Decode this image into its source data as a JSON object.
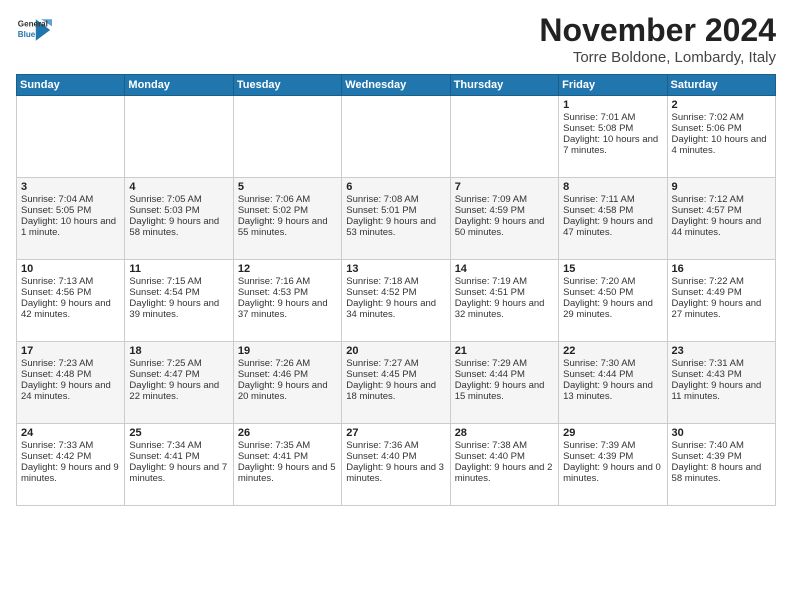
{
  "logo": {
    "general": "General",
    "blue": "Blue"
  },
  "title": "November 2024",
  "location": "Torre Boldone, Lombardy, Italy",
  "weekdays": [
    "Sunday",
    "Monday",
    "Tuesday",
    "Wednesday",
    "Thursday",
    "Friday",
    "Saturday"
  ],
  "weeks": [
    [
      {
        "day": "",
        "info": ""
      },
      {
        "day": "",
        "info": ""
      },
      {
        "day": "",
        "info": ""
      },
      {
        "day": "",
        "info": ""
      },
      {
        "day": "",
        "info": ""
      },
      {
        "day": "1",
        "info": "Sunrise: 7:01 AM\nSunset: 5:08 PM\nDaylight: 10 hours and 7 minutes."
      },
      {
        "day": "2",
        "info": "Sunrise: 7:02 AM\nSunset: 5:06 PM\nDaylight: 10 hours and 4 minutes."
      }
    ],
    [
      {
        "day": "3",
        "info": "Sunrise: 7:04 AM\nSunset: 5:05 PM\nDaylight: 10 hours and 1 minute."
      },
      {
        "day": "4",
        "info": "Sunrise: 7:05 AM\nSunset: 5:03 PM\nDaylight: 9 hours and 58 minutes."
      },
      {
        "day": "5",
        "info": "Sunrise: 7:06 AM\nSunset: 5:02 PM\nDaylight: 9 hours and 55 minutes."
      },
      {
        "day": "6",
        "info": "Sunrise: 7:08 AM\nSunset: 5:01 PM\nDaylight: 9 hours and 53 minutes."
      },
      {
        "day": "7",
        "info": "Sunrise: 7:09 AM\nSunset: 4:59 PM\nDaylight: 9 hours and 50 minutes."
      },
      {
        "day": "8",
        "info": "Sunrise: 7:11 AM\nSunset: 4:58 PM\nDaylight: 9 hours and 47 minutes."
      },
      {
        "day": "9",
        "info": "Sunrise: 7:12 AM\nSunset: 4:57 PM\nDaylight: 9 hours and 44 minutes."
      }
    ],
    [
      {
        "day": "10",
        "info": "Sunrise: 7:13 AM\nSunset: 4:56 PM\nDaylight: 9 hours and 42 minutes."
      },
      {
        "day": "11",
        "info": "Sunrise: 7:15 AM\nSunset: 4:54 PM\nDaylight: 9 hours and 39 minutes."
      },
      {
        "day": "12",
        "info": "Sunrise: 7:16 AM\nSunset: 4:53 PM\nDaylight: 9 hours and 37 minutes."
      },
      {
        "day": "13",
        "info": "Sunrise: 7:18 AM\nSunset: 4:52 PM\nDaylight: 9 hours and 34 minutes."
      },
      {
        "day": "14",
        "info": "Sunrise: 7:19 AM\nSunset: 4:51 PM\nDaylight: 9 hours and 32 minutes."
      },
      {
        "day": "15",
        "info": "Sunrise: 7:20 AM\nSunset: 4:50 PM\nDaylight: 9 hours and 29 minutes."
      },
      {
        "day": "16",
        "info": "Sunrise: 7:22 AM\nSunset: 4:49 PM\nDaylight: 9 hours and 27 minutes."
      }
    ],
    [
      {
        "day": "17",
        "info": "Sunrise: 7:23 AM\nSunset: 4:48 PM\nDaylight: 9 hours and 24 minutes."
      },
      {
        "day": "18",
        "info": "Sunrise: 7:25 AM\nSunset: 4:47 PM\nDaylight: 9 hours and 22 minutes."
      },
      {
        "day": "19",
        "info": "Sunrise: 7:26 AM\nSunset: 4:46 PM\nDaylight: 9 hours and 20 minutes."
      },
      {
        "day": "20",
        "info": "Sunrise: 7:27 AM\nSunset: 4:45 PM\nDaylight: 9 hours and 18 minutes."
      },
      {
        "day": "21",
        "info": "Sunrise: 7:29 AM\nSunset: 4:44 PM\nDaylight: 9 hours and 15 minutes."
      },
      {
        "day": "22",
        "info": "Sunrise: 7:30 AM\nSunset: 4:44 PM\nDaylight: 9 hours and 13 minutes."
      },
      {
        "day": "23",
        "info": "Sunrise: 7:31 AM\nSunset: 4:43 PM\nDaylight: 9 hours and 11 minutes."
      }
    ],
    [
      {
        "day": "24",
        "info": "Sunrise: 7:33 AM\nSunset: 4:42 PM\nDaylight: 9 hours and 9 minutes."
      },
      {
        "day": "25",
        "info": "Sunrise: 7:34 AM\nSunset: 4:41 PM\nDaylight: 9 hours and 7 minutes."
      },
      {
        "day": "26",
        "info": "Sunrise: 7:35 AM\nSunset: 4:41 PM\nDaylight: 9 hours and 5 minutes."
      },
      {
        "day": "27",
        "info": "Sunrise: 7:36 AM\nSunset: 4:40 PM\nDaylight: 9 hours and 3 minutes."
      },
      {
        "day": "28",
        "info": "Sunrise: 7:38 AM\nSunset: 4:40 PM\nDaylight: 9 hours and 2 minutes."
      },
      {
        "day": "29",
        "info": "Sunrise: 7:39 AM\nSunset: 4:39 PM\nDaylight: 9 hours and 0 minutes."
      },
      {
        "day": "30",
        "info": "Sunrise: 7:40 AM\nSunset: 4:39 PM\nDaylight: 8 hours and 58 minutes."
      }
    ]
  ]
}
